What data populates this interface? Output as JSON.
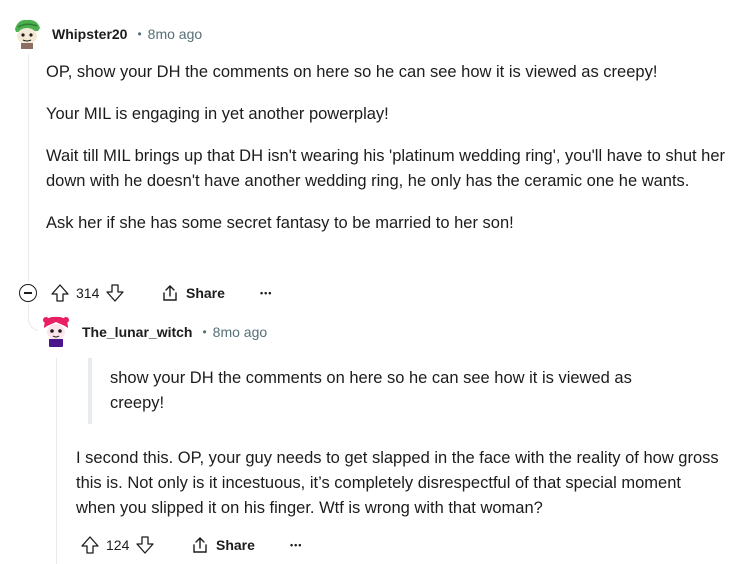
{
  "comment1": {
    "username": "Whipster20",
    "separator": "•",
    "time": "8mo ago",
    "paragraphs": [
      "OP, show your DH the comments on here so he can see how it is viewed as creepy!",
      "Your MIL is engaging in yet another powerplay!",
      "Wait till MIL brings up that DH isn't wearing his 'platinum wedding ring', you'll have to shut her down with he doesn't have another wedding ring, he only has the ceramic one he wants.",
      "Ask her if she has some secret fantasy to be married to her son!"
    ],
    "votes": "314",
    "share_label": "Share",
    "more_label": "•••"
  },
  "comment2": {
    "username": "The_lunar_witch",
    "separator": "•",
    "time": "8mo ago",
    "quote": "show your DH the comments on here so he can see how it is viewed as creepy!",
    "body": "I second this. OP, your guy needs to get slapped in the face with the reality of how gross this is. Not only is it incestuous, it’s completely disrespectful of that special moment when you slipped it on his finger. Wtf is wrong with that woman?",
    "votes": "124",
    "share_label": "Share",
    "more_label": "•••"
  },
  "colors": {
    "text": "#1c1c1c",
    "meta": "#576f76",
    "thread_line": "#e5ebee"
  },
  "icons": {
    "upvote": "upvote-icon",
    "downvote": "downvote-icon",
    "share": "share-icon",
    "collapse": "collapse-thread-icon"
  }
}
